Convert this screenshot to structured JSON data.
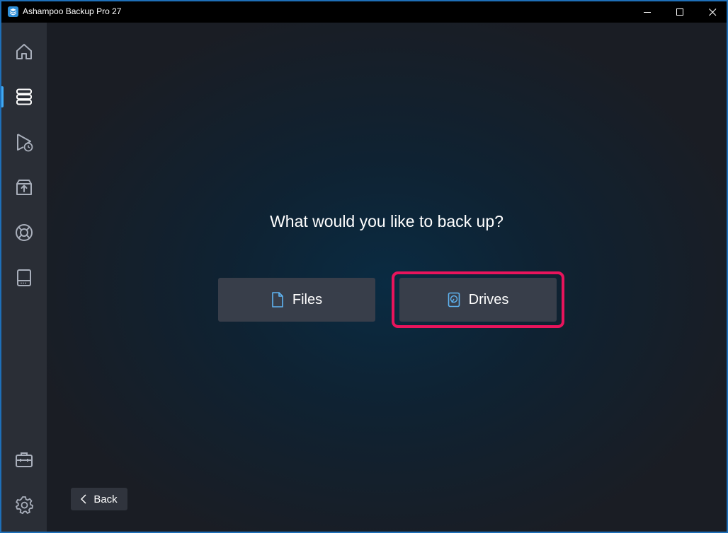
{
  "window": {
    "title": "Ashampoo Backup Pro 27"
  },
  "sidebar": {
    "items": [
      {
        "icon": "home-icon",
        "active": false
      },
      {
        "icon": "backup-stack-icon",
        "active": true
      },
      {
        "icon": "play-schedule-icon",
        "active": false
      },
      {
        "icon": "restore-box-icon",
        "active": false
      },
      {
        "icon": "lifebuoy-icon",
        "active": false
      },
      {
        "icon": "drive-icon",
        "active": false
      }
    ],
    "bottom_items": [
      {
        "icon": "toolbox-icon"
      },
      {
        "icon": "gear-icon"
      }
    ]
  },
  "main": {
    "question": "What would you like to back up?",
    "options": [
      {
        "label": "Files",
        "icon": "file-icon"
      },
      {
        "label": "Drives",
        "icon": "drive-disk-icon",
        "highlighted": true
      }
    ],
    "back_label": "Back"
  },
  "colors": {
    "accent": "#3fa9f5",
    "highlight": "#e8145c",
    "button_bg": "#383e4a",
    "sidebar_bg": "#2a2e36"
  }
}
